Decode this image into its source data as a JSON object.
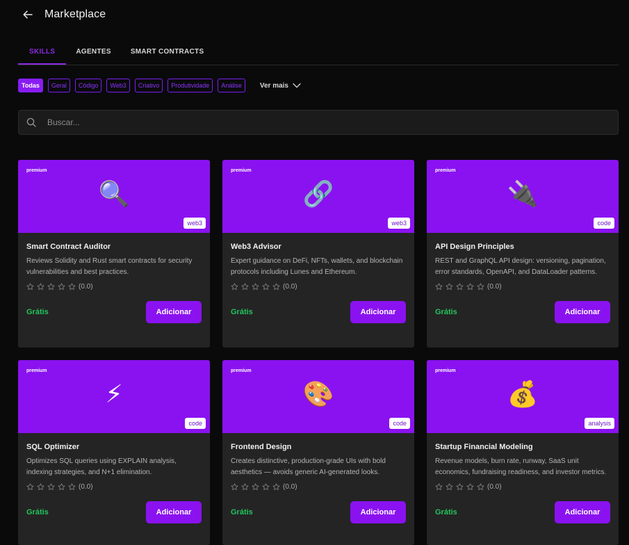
{
  "header": {
    "title": "Marketplace"
  },
  "tabs": [
    {
      "label": "SKILLS"
    },
    {
      "label": "AGENTES"
    },
    {
      "label": "SMART CONTRACTS"
    }
  ],
  "filters": [
    {
      "label": "Todas"
    },
    {
      "label": "Geral"
    },
    {
      "label": "Código"
    },
    {
      "label": "Web3"
    },
    {
      "label": "Criativo"
    },
    {
      "label": "Produtividade"
    },
    {
      "label": "Análise"
    }
  ],
  "more_label": "Ver mais",
  "search": {
    "placeholder": "Buscar..."
  },
  "colors": {
    "accent": "#8a12f0",
    "price": "#22c55e",
    "background": "#0a0a0a",
    "card": "#242424"
  },
  "cards": [
    {
      "badge": "premium",
      "icon": "magnifier-icon",
      "emoji": "🔍",
      "tag": "web3",
      "name": "Smart Contract Auditor",
      "description": "Reviews Solidity and Rust smart contracts for security vulnerabilities and best practices.",
      "rating": "(0.0)",
      "price": "Grátis",
      "button": "Adicionar"
    },
    {
      "badge": "premium",
      "icon": "chain-link-icon",
      "emoji": "🔗",
      "tag": "web3",
      "name": "Web3 Advisor",
      "description": "Expert guidance on DeFi, NFTs, wallets, and blockchain protocols including Lunes and Ethereum.",
      "rating": "(0.0)",
      "price": "Grátis",
      "button": "Adicionar"
    },
    {
      "badge": "premium",
      "icon": "plug-icon",
      "emoji": "🔌",
      "tag": "code",
      "name": "API Design Principles",
      "description": "REST and GraphQL API design: versioning, pagination, error standards, OpenAPI, and DataLoader patterns.",
      "rating": "(0.0)",
      "price": "Grátis",
      "button": "Adicionar"
    },
    {
      "badge": "premium",
      "icon": "lightning-icon",
      "emoji": "⚡",
      "tag": "code",
      "name": "SQL Optimizer",
      "description": "Optimizes SQL queries using EXPLAIN analysis, indexing strategies, and N+1 elimination.",
      "rating": "(0.0)",
      "price": "Grátis",
      "button": "Adicionar"
    },
    {
      "badge": "premium",
      "icon": "palette-icon",
      "emoji": "🎨",
      "tag": "code",
      "name": "Frontend Design",
      "description": "Creates distinctive, production-grade UIs with bold aesthetics — avoids generic AI-generated looks.",
      "rating": "(0.0)",
      "price": "Grátis",
      "button": "Adicionar"
    },
    {
      "badge": "premium",
      "icon": "money-bag-icon",
      "emoji": "💰",
      "tag": "analysis",
      "name": "Startup Financial Modeling",
      "description": "Revenue models, burn rate, runway, SaaS unit economics, fundraising readiness, and investor metrics.",
      "rating": "(0.0)",
      "price": "Grátis",
      "button": "Adicionar"
    }
  ]
}
